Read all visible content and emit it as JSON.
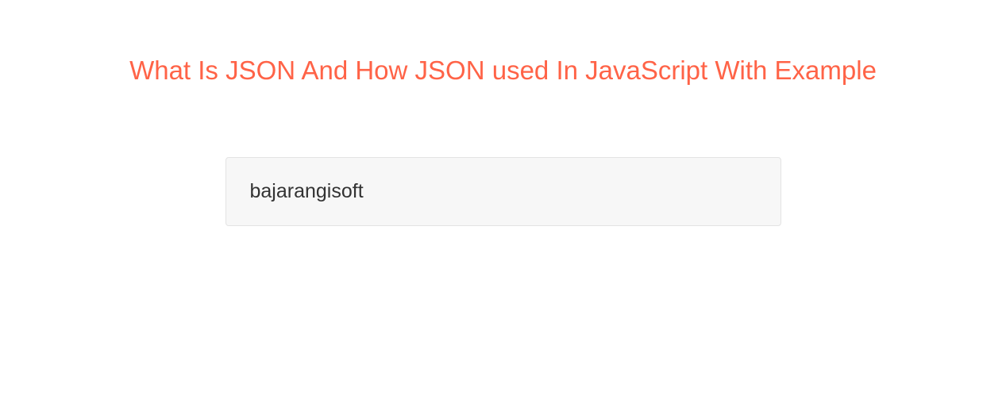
{
  "header": {
    "title": "What Is JSON And How JSON used In JavaScript With Example"
  },
  "main": {
    "box_content": "bajarangisoft"
  }
}
